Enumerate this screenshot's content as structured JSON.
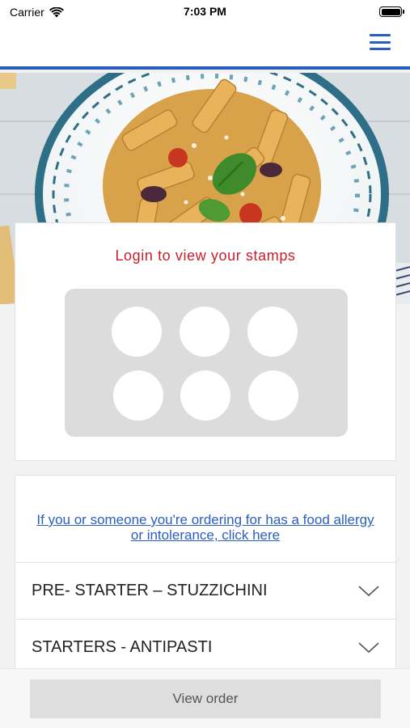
{
  "status_bar": {
    "carrier": "Carrier",
    "time": "7:03 PM",
    "icons": [
      "wifi-icon",
      "battery-icon"
    ]
  },
  "header": {
    "menu_icon": "hamburger-menu-icon",
    "accent_color": "#2a5fbf"
  },
  "hero": {
    "image": "penne-pasta-dish-photo"
  },
  "stamps": {
    "title": "Login to view your stamps",
    "title_color": "#c8202b",
    "stamp_count": 6
  },
  "menu": {
    "allergy_link": "If you or someone you're ordering for has a food allergy or intolerance, click here",
    "categories": [
      {
        "label": "PRE- STARTER – STUZZICHINI"
      },
      {
        "label": "STARTERS - ANTIPASTI"
      }
    ],
    "chevron_icon": "chevron-down-icon"
  },
  "footer": {
    "view_order_label": "View order"
  }
}
